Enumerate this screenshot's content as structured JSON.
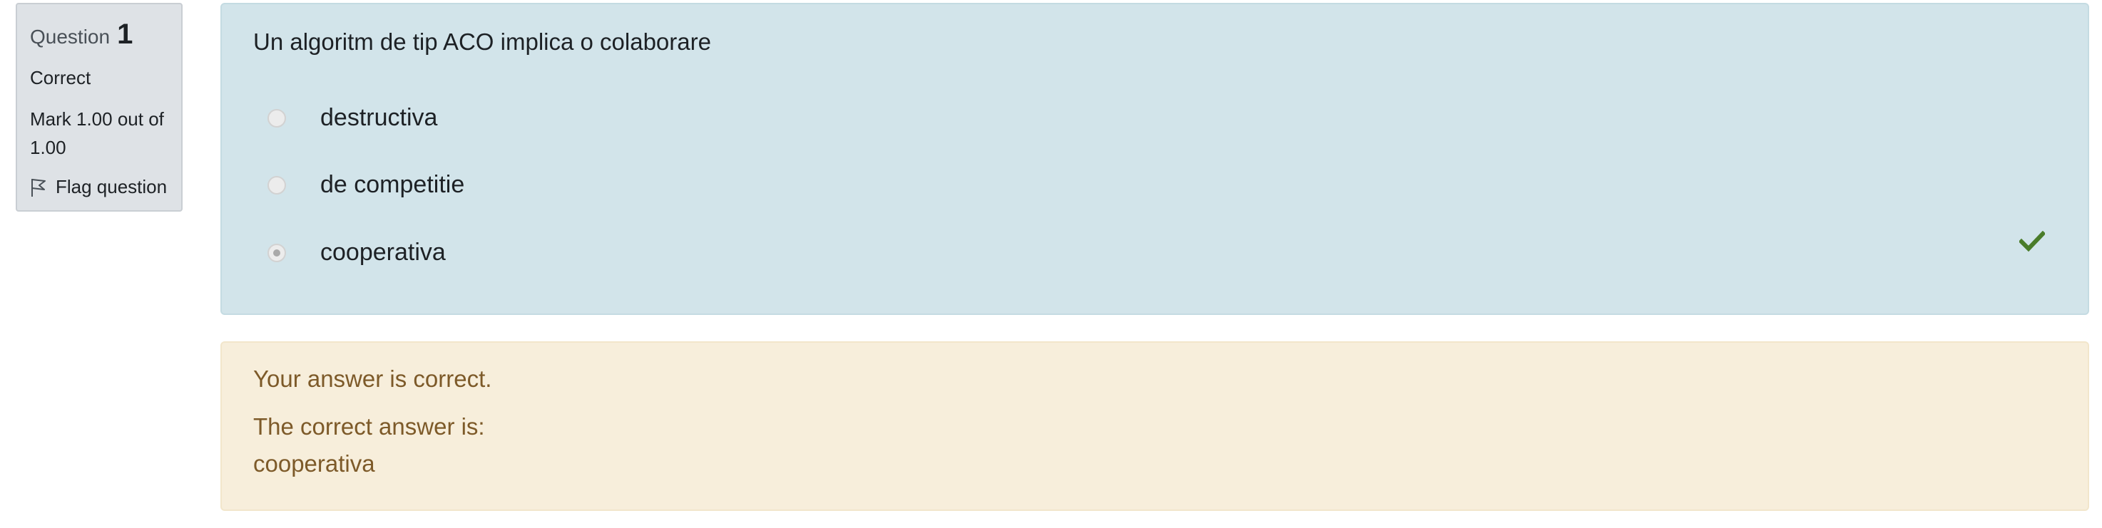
{
  "info": {
    "question_label": "Question",
    "question_number": "1",
    "state": "Correct",
    "grade": "Mark 1.00 out of 1.00",
    "flag_label": "Flag question"
  },
  "question": {
    "text": "Un algoritm de tip ACO implica o colaborare",
    "options": [
      {
        "label": "destructiva",
        "selected": false
      },
      {
        "label": "de competitie",
        "selected": false
      },
      {
        "label": "cooperativa",
        "selected": true
      }
    ],
    "correct_icon": "check-icon",
    "correct_color": "#4a7c2a"
  },
  "feedback": {
    "general": "Your answer is correct.",
    "right_answer_intro": "The correct answer is:",
    "right_answer": "cooperativa"
  }
}
